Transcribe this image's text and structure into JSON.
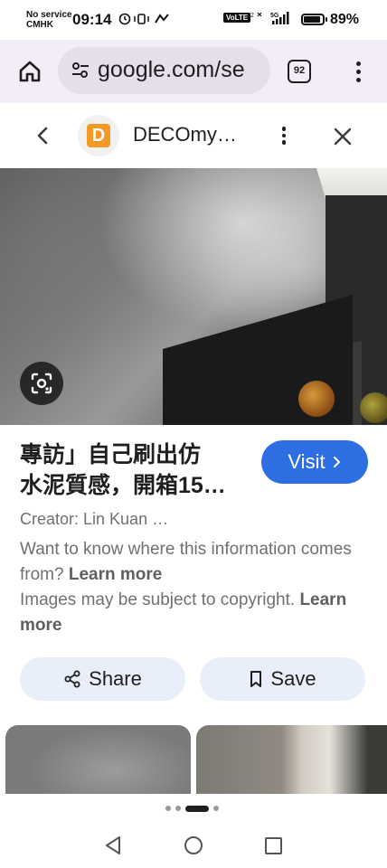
{
  "status_bar": {
    "carrier_line1": "No service",
    "carrier_line2": "CMHK",
    "time": "09:14",
    "volte": "VoLTE",
    "network": "5G",
    "battery_level": 0.89,
    "battery_percent": "89%"
  },
  "browser": {
    "url": "google.com/se",
    "tab_count": "92"
  },
  "panel": {
    "site_logo_letter": "D",
    "site_name": "DECOmy…"
  },
  "result": {
    "title_line1": "專訪」自己刷出仿",
    "title_line2": "水泥質感，開箱15…",
    "visit_label": "Visit",
    "creator": "Creator: Lin Kuan …",
    "info_text1": "Want to know where this information comes from?",
    "info_link1": "Learn more",
    "info_text2": "Images may be subject to copyright.",
    "info_link2": "Learn more",
    "share_label": "Share",
    "save_label": "Save"
  },
  "pager": {
    "count": 4,
    "active_index": 2
  },
  "icons": {
    "home": "home-icon",
    "site_settings": "tune-icon",
    "tabs": "tabs-icon",
    "menu": "more-vert-icon",
    "back": "chevron-left-icon",
    "panel_menu": "more-vert-icon",
    "close": "close-icon",
    "lens": "lens-icon",
    "visit": "chevron-right-icon",
    "share": "share-icon",
    "save": "bookmark-icon"
  },
  "colors": {
    "accent": "#2d6fe3",
    "toolbar_bg": "#f3edf7",
    "chip_bg": "#e8eefa",
    "logo": "#f29a25"
  }
}
